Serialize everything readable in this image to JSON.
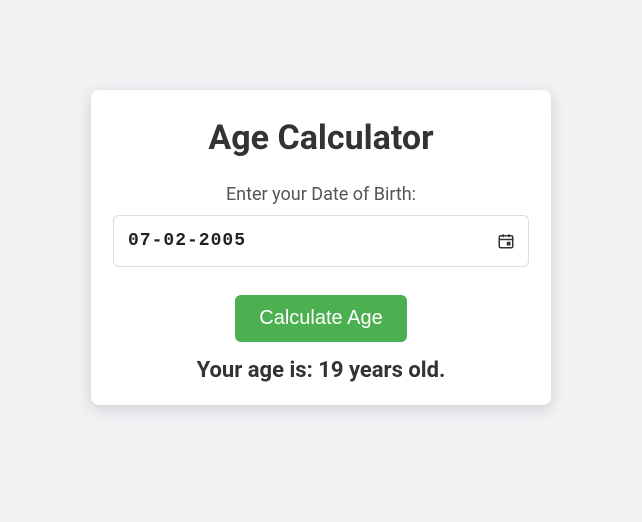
{
  "card": {
    "title": "Age Calculator",
    "label": "Enter your Date of Birth:",
    "date_value": "07-02-2005",
    "button_label": "Calculate Age",
    "result_text": "Your age is: 19 years old."
  }
}
